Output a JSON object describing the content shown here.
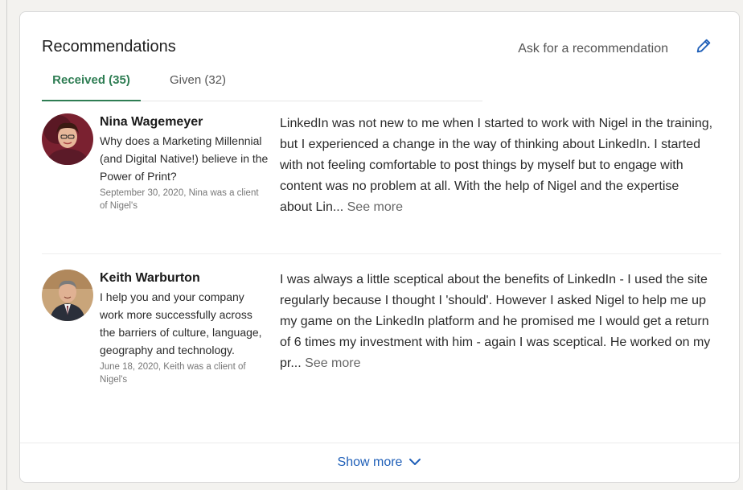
{
  "card": {
    "title": "Recommendations",
    "ask_link": "Ask for a recommendation",
    "edit_icon": "pencil-icon"
  },
  "tabs": [
    {
      "label": "Received (35)",
      "active": true
    },
    {
      "label": "Given (32)",
      "active": false
    }
  ],
  "recommendations": [
    {
      "name": "Nina Wagemeyer",
      "headline": "Why does a Marketing Millennial (and Digital Native!) believe in the Power of Print?",
      "meta": "September 30, 2020, Nina was a client of Nigel's",
      "text": "LinkedIn was not new to me when I started to work with Nigel in the training, but I experienced a change in the way of thinking about LinkedIn. I started with not feeling comfortable to post things by myself but to engage with content was no problem at all. With the help of Nigel and the expertise about Lin...",
      "see_more": "See more"
    },
    {
      "name": "Keith Warburton",
      "headline": "I help you and your company work more successfully across the barriers of culture, language, geography and technology.",
      "meta": "June 18, 2020, Keith was a client of Nigel's",
      "text": "I was always a little sceptical about the benefits of LinkedIn - I used the site regularly because I thought I 'should'. However I asked Nigel to help me up my game on the LinkedIn platform and he promised me I would get a return of 6 times my investment with him - again I was sceptical. He worked on my pr...",
      "see_more": "See more"
    }
  ],
  "footer": {
    "show_more": "Show more",
    "chevron_icon": "chevron-down-icon"
  },
  "colors": {
    "accent_green": "#2e7d53",
    "link_blue": "#1f5fb8"
  }
}
